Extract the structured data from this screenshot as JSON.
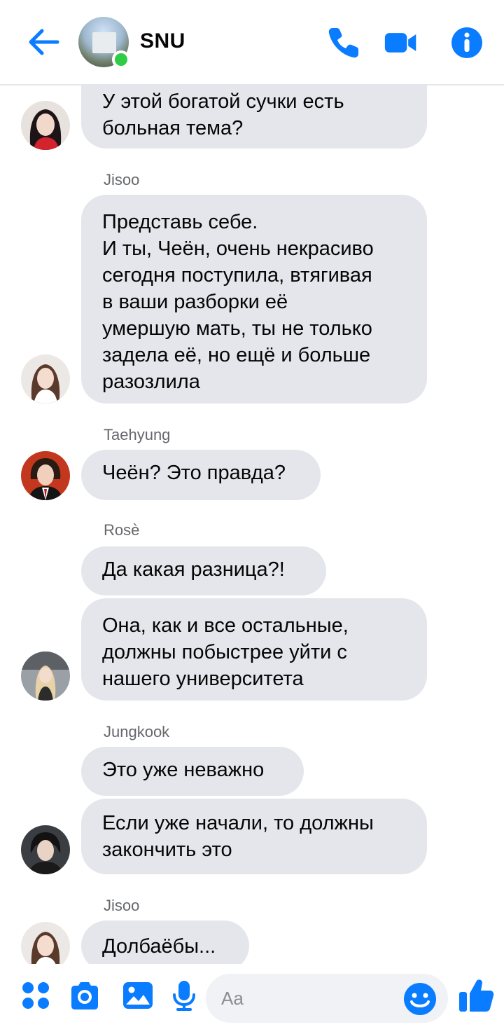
{
  "header": {
    "title": "SNU",
    "back_icon": "arrow-left-icon",
    "call_icon": "phone-icon",
    "video_icon": "video-camera-icon",
    "info_icon": "info-icon",
    "accent": "#0a7cff",
    "online_color": "#31cc46"
  },
  "messages": [
    {
      "sender": "",
      "texts": [
        "У этой богатой сучки есть\nбольная тема?"
      ]
    },
    {
      "sender": "Jisoo",
      "texts": [
        "Представь себе.\nИ ты, Чеён, очень некрасиво\nсегодня поступила, втягивая\nв ваши разборки её\nумершую мать, ты не только\nзадела её, но ещё и больше\nразозлила"
      ]
    },
    {
      "sender": "Taehyung",
      "texts": [
        "Чеён? Это правда?"
      ]
    },
    {
      "sender": "Rosè",
      "texts": [
        "Да какая разница?!",
        "Она, как и все остальные,\nдолжны побыстрее уйти с\nнашего университета"
      ]
    },
    {
      "sender": "Jungkook",
      "texts": [
        "Это уже неважно",
        "Если уже начали, то должны\nзакончить это"
      ]
    },
    {
      "sender": "Jisoo",
      "texts": [
        "Долбаёбы..."
      ]
    }
  ],
  "composer": {
    "placeholder": "Aa",
    "value": "",
    "menu_icon": "four-dots-menu-icon",
    "camera_icon": "camera-icon",
    "gallery_icon": "image-gallery-icon",
    "mic_icon": "microphone-icon",
    "emoji_icon": "smiley-icon",
    "like_icon": "thumbs-up-icon"
  }
}
